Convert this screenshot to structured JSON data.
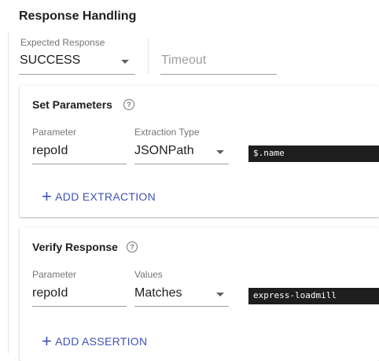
{
  "response_handling": {
    "title": "Response Handling",
    "expected_response": {
      "label": "Expected Response",
      "value": "SUCCESS"
    },
    "timeout": {
      "placeholder": "Timeout"
    }
  },
  "set_parameters": {
    "title": "Set Parameters",
    "parameter_label": "Parameter",
    "parameter_value": "repoId",
    "extraction_type_label": "Extraction Type",
    "extraction_type_value": "JSONPath",
    "extraction_expression": "$.name",
    "add_button": "ADD EXTRACTION"
  },
  "verify_response": {
    "title": "Verify Response",
    "parameter_label": "Parameter",
    "parameter_value": "repoId",
    "values_label": "Values",
    "values_value": "Matches",
    "assertion_value": "express-loadmill",
    "add_button": "ADD ASSERTION"
  },
  "colors": {
    "accent": "#3f51b5",
    "code_bg": "#1e1e1e"
  }
}
